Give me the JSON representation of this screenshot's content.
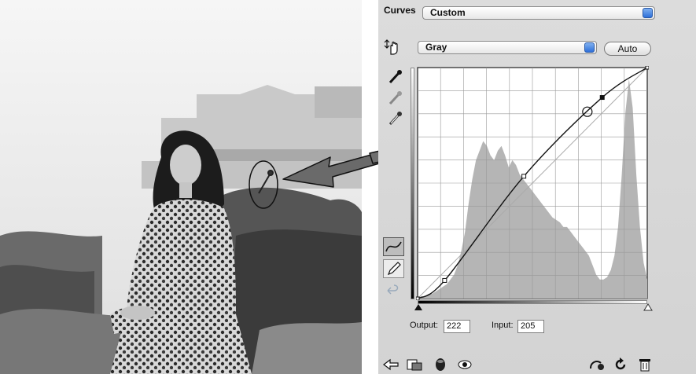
{
  "panel": {
    "preset_label": "Curves",
    "preset_value": "Custom",
    "channel_value": "Gray",
    "auto_label": "Auto",
    "output_label": "Output:",
    "output_value": "222",
    "input_label": "Input:",
    "input_value": "205"
  },
  "curve": {
    "points": [
      [
        0,
        0
      ],
      [
        30,
        20
      ],
      [
        118,
        135
      ],
      [
        205,
        222
      ],
      [
        255,
        255
      ]
    ],
    "selected_point": [
      205,
      222
    ],
    "grid_divisions": 10
  },
  "histogram": [
    0,
    1,
    1,
    2,
    2,
    3,
    4,
    5,
    6,
    8,
    10,
    14,
    20,
    28,
    40,
    50,
    58,
    62,
    66,
    64,
    60,
    58,
    62,
    64,
    60,
    55,
    58,
    56,
    52,
    50,
    48,
    46,
    44,
    42,
    40,
    38,
    36,
    34,
    33,
    32,
    30,
    30,
    28,
    26,
    24,
    22,
    20,
    18,
    14,
    10,
    8,
    8,
    9,
    12,
    18,
    30,
    52,
    78,
    92,
    80,
    52,
    30,
    15,
    8
  ],
  "colors": {
    "panel_bg": "#d6d6d6",
    "stepper_blue": "#3a7be0",
    "histogram": "#b5b5b5"
  },
  "icons": [
    "hand-adjust-icon",
    "black-eyedropper-icon",
    "gray-eyedropper-icon",
    "white-eyedropper-icon",
    "curve-tool-icon",
    "pencil-tool-icon",
    "smooth-icon",
    "clip-to-layer-icon",
    "view-previous-icon",
    "visibility-eye-icon",
    "reset-icon",
    "trash-icon"
  ]
}
